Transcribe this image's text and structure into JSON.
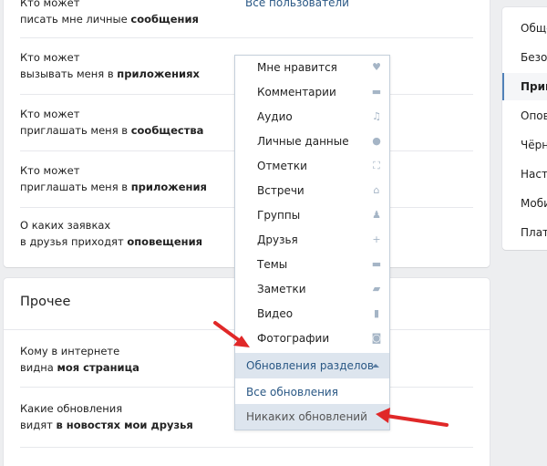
{
  "privacy": {
    "rows": [
      {
        "prefix": "Кто может",
        "line2_plain": "писать мне личные ",
        "line2_bold": "сообщения",
        "value": "Все пользователи"
      },
      {
        "prefix": "Кто может",
        "line2_plain": "вызывать меня в ",
        "line2_bold": "приложениях",
        "value": ""
      },
      {
        "prefix": "Кто может",
        "line2_plain": "приглашать меня в ",
        "line2_bold": "сообщества",
        "value": ""
      },
      {
        "prefix": "Кто может",
        "line2_plain": "приглашать меня в ",
        "line2_bold": "приложения",
        "value": ""
      },
      {
        "prefix": "О каких заявках",
        "line2_plain": "в друзья приходят ",
        "line2_bold": "оповещения",
        "value": ""
      }
    ]
  },
  "other": {
    "title": "Прочее",
    "rows": [
      {
        "line1": "Кому в интернете",
        "line2_plain": "видна ",
        "line2_bold": "моя страница"
      },
      {
        "line1": "Какие обновления",
        "line2_plain": "видят ",
        "line2_bold": "в новостях мои друзья"
      }
    ]
  },
  "nav": {
    "items": [
      {
        "label": "Общее",
        "active": false
      },
      {
        "label": "Безопасность",
        "active": false
      },
      {
        "label": "Приватность",
        "active": true
      },
      {
        "label": "Оповещения",
        "active": false
      },
      {
        "label": "Чёрный список",
        "active": false
      },
      {
        "label": "Настройки приложений",
        "active": false
      },
      {
        "label": "Мобильные сервисы",
        "active": false
      },
      {
        "label": "Платежи",
        "active": false
      }
    ]
  },
  "dropdown": {
    "items": [
      {
        "label": "Мне нравится",
        "icon": "heart-icon",
        "glyph": "♥"
      },
      {
        "label": "Комментарии",
        "icon": "comment-icon",
        "glyph": "▬"
      },
      {
        "label": "Аудио",
        "icon": "music-note-icon",
        "glyph": "♫"
      },
      {
        "label": "Личные данные",
        "icon": "person-icon",
        "glyph": "●"
      },
      {
        "label": "Отметки",
        "icon": "tag-frame-icon",
        "glyph": "⛶"
      },
      {
        "label": "Встречи",
        "icon": "house-icon",
        "glyph": "⌂"
      },
      {
        "label": "Группы",
        "icon": "group-icon",
        "glyph": "♟"
      },
      {
        "label": "Друзья",
        "icon": "plus-icon",
        "glyph": "+"
      },
      {
        "label": "Темы",
        "icon": "speech-bubble-icon",
        "glyph": "▬"
      },
      {
        "label": "Заметки",
        "icon": "note-icon",
        "glyph": "▰"
      },
      {
        "label": "Видео",
        "icon": "film-icon",
        "glyph": "▮"
      },
      {
        "label": "Фотографии",
        "icon": "camera-icon",
        "glyph": "◙"
      }
    ],
    "header": "Обновления разделов",
    "options": [
      {
        "label": "Все обновления",
        "selected": false
      },
      {
        "label": "Никаких обновлений",
        "selected": true
      }
    ]
  },
  "colors": {
    "link": "#2a5885",
    "highlight": "#dde5ee",
    "accent": "#5181b8",
    "arrow": "#e02828"
  }
}
